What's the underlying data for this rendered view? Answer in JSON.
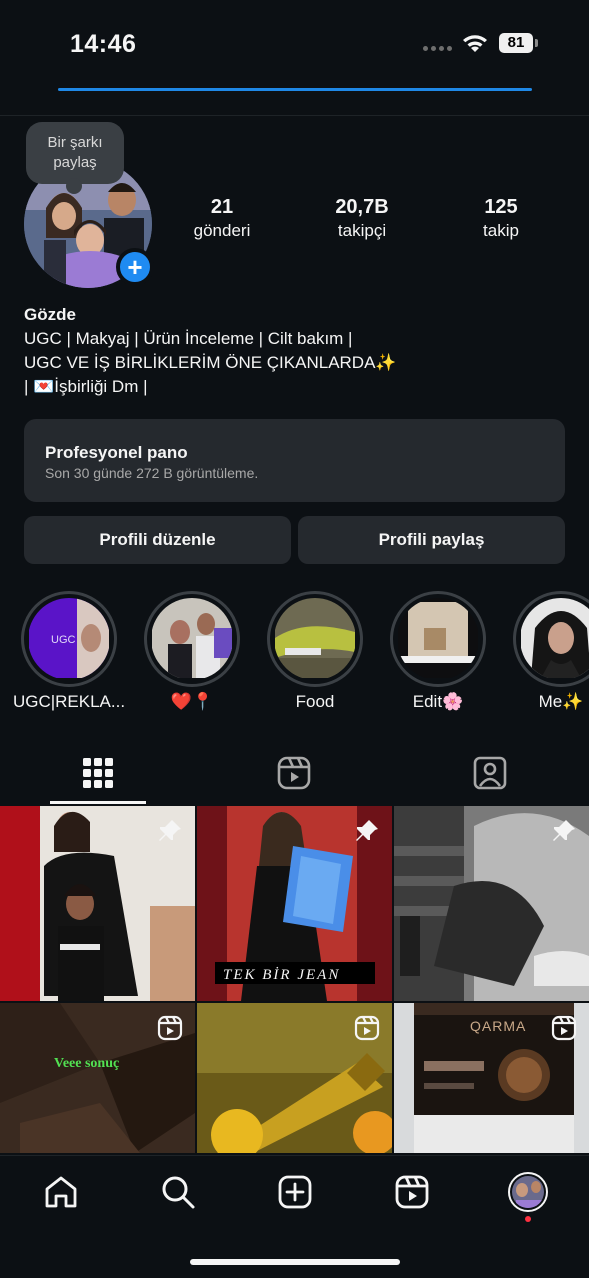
{
  "status_bar": {
    "time": "14:46",
    "battery": "81"
  },
  "profile": {
    "note": "Bir şarkı paylaş",
    "stats": [
      {
        "value": "21",
        "label": "gönderi"
      },
      {
        "value": "20,7B",
        "label": "takipçi"
      },
      {
        "value": "125",
        "label": "takip"
      }
    ],
    "name": "Gözde",
    "bio_lines": [
      "UGC | Makyaj | Ürün İnceleme | Cilt bakım |",
      "UGC VE İŞ BİRLİKLERİM ÖNE ÇIKANLARDA✨",
      "| 💌İşbirliği Dm |"
    ]
  },
  "pro_panel": {
    "title": "Profesyonel pano",
    "subtitle": "Son 30 günde 272 B görüntüleme."
  },
  "buttons": {
    "edit": "Profili düzenle",
    "share": "Profili paylaş"
  },
  "highlights": [
    {
      "label": "UGC|REKLA...",
      "inner_text": "UGC"
    },
    {
      "label": "❤️📍"
    },
    {
      "label": "Food"
    },
    {
      "label": "Edit🌸"
    },
    {
      "label": "Me✨"
    }
  ],
  "tabs": [
    "grid-icon",
    "reels-icon",
    "tagged-icon"
  ],
  "grid": {
    "posts": [
      {
        "type": "pinned",
        "overlay": ""
      },
      {
        "type": "pinned",
        "overlay": "TEK BİR JEAN"
      },
      {
        "type": "pinned",
        "overlay": ""
      },
      {
        "type": "reel",
        "overlay": "Veee sonuç"
      },
      {
        "type": "reel",
        "overlay": ""
      },
      {
        "type": "reel",
        "overlay": "QARMA"
      }
    ]
  },
  "bottom_nav": [
    "home-icon",
    "search-icon",
    "create-icon",
    "reels-icon",
    "profile-avatar"
  ],
  "colors": {
    "accent": "#1f8bf2",
    "background": "#0c1014",
    "panel": "#25292e",
    "notification": "#ff3040"
  }
}
